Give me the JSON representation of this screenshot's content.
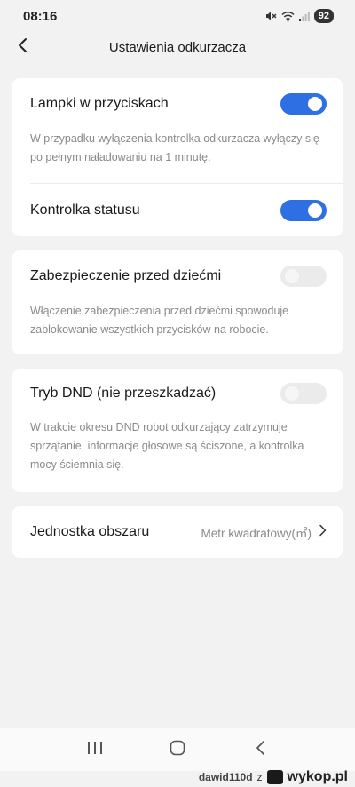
{
  "status_bar": {
    "time": "08:16",
    "battery": "92",
    "icons": [
      "mute-icon",
      "wifi-icon",
      "signal-icon",
      "battery-icon"
    ]
  },
  "header": {
    "title": "Ustawienia odkurzacza",
    "back_icon": "chevron-left-icon"
  },
  "settings": {
    "button_lights": {
      "label": "Lampki w przyciskach",
      "enabled": true,
      "description": "W przypadku wyłączenia kontrolka odkurzacza wyłączy się po pełnym naładowaniu na 1 minutę."
    },
    "status_light": {
      "label": "Kontrolka statusu",
      "enabled": true
    },
    "child_lock": {
      "label": "Zabezpieczenie przed dziećmi",
      "enabled": false,
      "description": "Włączenie zabezpieczenia przed dziećmi spowoduje zablokowanie wszystkich przycisków na robocie."
    },
    "dnd": {
      "label": "Tryb DND (nie przeszkadzać)",
      "enabled": false,
      "description": "W trakcie okresu DND robot odkurzający zatrzymuje sprzątanie, informacje głosowe są ściszone, a kontrolka mocy ściemnia się."
    },
    "area_unit": {
      "label": "Jednostka obszaru",
      "value": "Metr kwadratowy(㎡)"
    }
  },
  "nav_bar": {
    "icons": [
      "recent-apps-icon",
      "home-icon",
      "back-icon"
    ]
  },
  "watermark": {
    "user": "dawid110d",
    "connector": "z",
    "site": "wykop.pl"
  },
  "colors": {
    "accent": "#2f6fe4",
    "background": "#f2f2f2",
    "card": "#ffffff",
    "secondary_text": "#8a8a8a"
  }
}
